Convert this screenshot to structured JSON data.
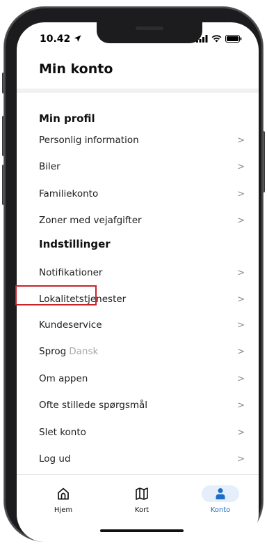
{
  "status": {
    "time": "10.42"
  },
  "header": {
    "title": "Min konto"
  },
  "sections": [
    {
      "heading": "Min profil",
      "items": [
        {
          "label": "Personlig information"
        },
        {
          "label": "Biler"
        },
        {
          "label": "Familiekonto"
        },
        {
          "label": "Zoner med vejafgifter"
        }
      ]
    },
    {
      "heading": "Indstillinger",
      "items": [
        {
          "label": "Notifikationer"
        },
        {
          "label": "Lokalitetstjenester"
        },
        {
          "label": "Kundeservice",
          "highlighted": true
        },
        {
          "label": "Sprog",
          "sub": "Dansk"
        },
        {
          "label": "Om appen"
        },
        {
          "label": "Ofte stillede spørgsmål"
        },
        {
          "label": "Slet konto"
        },
        {
          "label": "Log ud"
        }
      ]
    }
  ],
  "chevron": ">",
  "tabs": [
    {
      "label": "Hjem",
      "icon": "home-icon"
    },
    {
      "label": "Kort",
      "icon": "map-icon"
    },
    {
      "label": "Konto",
      "icon": "person-icon",
      "active": true
    }
  ],
  "colors": {
    "accent": "#1f6cc6",
    "highlight_box": "#c8232a"
  }
}
